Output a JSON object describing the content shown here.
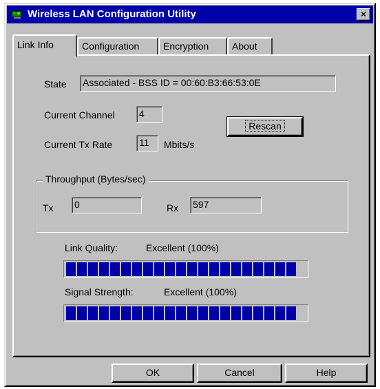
{
  "window": {
    "title": "Wireless LAN Configuration Utility",
    "close_glyph": "×"
  },
  "tabs": [
    {
      "label": "Link Info",
      "active": true
    },
    {
      "label": "Configuration",
      "active": false
    },
    {
      "label": "Encryption",
      "active": false
    },
    {
      "label": "About",
      "active": false
    }
  ],
  "link_info": {
    "state_label": "State",
    "state_value": "Associated - BSS ID = 00:60:B3:66:53:0E",
    "channel_label": "Current Channel",
    "channel_value": "4",
    "tx_rate_label": "Current Tx Rate",
    "tx_rate_value": "11",
    "tx_rate_unit": "Mbits/s",
    "rescan_label": "Rescan"
  },
  "throughput": {
    "title": "Throughput (Bytes/sec)",
    "tx_label": "Tx",
    "tx_value": "0",
    "rx_label": "Rx",
    "rx_value": "597"
  },
  "link_quality": {
    "label": "Link Quality:",
    "value": "Excellent (100%)",
    "level": 1.0
  },
  "signal_strength": {
    "label": "Signal Strength:",
    "value": "Excellent (100%)",
    "level": 1.0
  },
  "buttons": {
    "ok": "OK",
    "cancel": "Cancel",
    "help": "Help"
  },
  "colors": {
    "titlebar": "#0000a8",
    "face": "#c0c0c0",
    "bar_fill": "#0000a8"
  },
  "icons": {
    "app": "network-card-icon"
  }
}
